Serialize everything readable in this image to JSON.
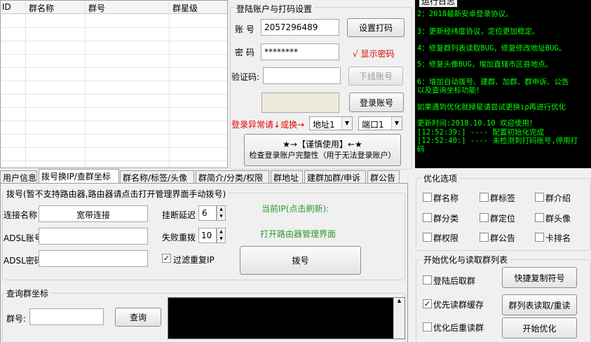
{
  "grid": {
    "columns": [
      "ID",
      "群名称",
      "群号",
      "群星级"
    ]
  },
  "login": {
    "title": "登陆账户与打码设置",
    "account_label": "账 号",
    "account_value": "2057296489",
    "password_label": "密 码",
    "password_value": "********",
    "captcha_label": "验证码:",
    "captcha_value": "",
    "set_captcha_btn": "设置打码",
    "show_password": "√ 显示密码",
    "logout_btn": "下线账号",
    "login_btn": "登录账号",
    "abnormal_text": "登录异常请↓或换→",
    "address_select": "地址1",
    "port_select": "端口1",
    "check_btn_line1": "★→【谨慎使用】←★",
    "check_btn_line2": "检查登录账户完整性（用于无法登录账户）"
  },
  "log": {
    "title": "运行日志",
    "lines": [
      "2：2018最新安卓登录协议。",
      "3：更新经纬度协议，定位更加稳定。",
      "4：修复群列表读取BUG，修复修改地址BUG。",
      "5：修复头像BUG，增加直辖市区县地点。",
      "6：增加自动拨号、建群、加群、群申诉、公告",
      "以及查询坐标功能！",
      "如果遇到优化就掉星请尝试更换ip再进行优化",
      "更新时间:2018.10.10  欢迎使用！",
      "[12:52:39:] ---- 配置初始化完成",
      "[12:52:40:] ---- 未检测到打码账号,停用打",
      "码"
    ]
  },
  "tabs": [
    "用户信息",
    "拨号换IP/查群坐标",
    "群名称/标签/头像",
    "群简介/分类/权限",
    "群地址",
    "建群加群/申诉",
    "群公告"
  ],
  "dial": {
    "title": "拨号(暂不支持路由器,路由器请点击打开管理界面手动拨号)",
    "conn_label": "连接名称",
    "conn_value": "宽带连接",
    "adsl_user_label": "ADSL账号",
    "adsl_pass_label": "ADSL密码",
    "disconnect_delay_label": "挂断延迟",
    "disconnect_delay_value": "6",
    "retry_label": "失败重拨",
    "retry_value": "10",
    "filter_ip_label": "过滤重复IP",
    "current_ip": "当前IP(点击刷新):",
    "open_router": "打开路由器管理界面",
    "dial_btn": "拨号"
  },
  "query": {
    "title": "查询群坐标",
    "group_label": "群号:",
    "query_btn": "查询"
  },
  "options": {
    "title": "优化选项",
    "items": [
      "群名称",
      "群标签",
      "群介绍",
      "群分类",
      "群定位",
      "群头像",
      "群权限",
      "群公告",
      "卡排名"
    ]
  },
  "optimize": {
    "title": "开始优化与读取群列表",
    "after_login": "登陆后取群",
    "read_cache": "优先读群缓存",
    "reread_after": "优化后重读群",
    "quick_copy_btn": "快捷复制符号",
    "read_list_btn": "群列表读取/重读",
    "start_btn": "开始优化"
  }
}
